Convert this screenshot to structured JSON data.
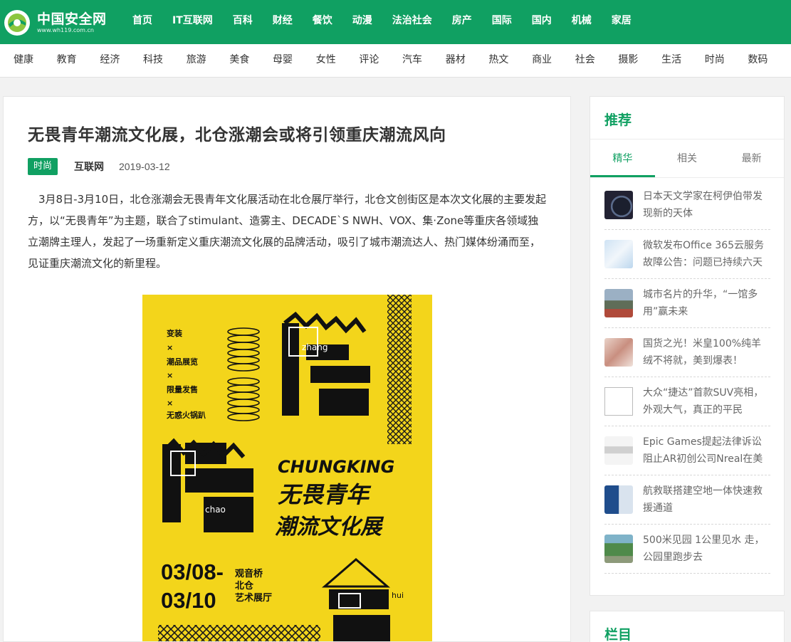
{
  "site": {
    "logo_text": "中国安全网",
    "logo_url": "www.wh119.com.cn",
    "brand_color": "#10a062"
  },
  "main_nav": [
    "首页",
    "IT互联网",
    "百科",
    "财经",
    "餐饮",
    "动漫",
    "法治社会",
    "房产",
    "国际",
    "国内",
    "机械",
    "家居"
  ],
  "sub_nav": [
    "健康",
    "教育",
    "经济",
    "科技",
    "旅游",
    "美食",
    "母婴",
    "女性",
    "评论",
    "汽车",
    "器材",
    "热文",
    "商业",
    "社会",
    "摄影",
    "生活",
    "时尚",
    "数码"
  ],
  "article": {
    "title": "无畏青年潮流文化展，北仓涨潮会或将引领重庆潮流风向",
    "tag": "时尚",
    "source": "互联网",
    "date": "2019-03-12",
    "body": "3月8日-3月10日，北仓涨潮会无畏青年文化展活动在北仓展厅举行，北仓文创街区是本次文化展的主要发起方，以“无畏青年”为主题，联合了stimulant、造雾主、DECADE`S NWH、VOX、集·Zone等重庆各领域独立潮牌主理人，发起了一场重新定义重庆潮流文化展的品牌活动，吸引了城市潮流达人、热门媒体纷涌而至，见证重庆潮流文化的新里程。",
    "poster": {
      "bg_color": "#f3d51b",
      "list": [
        "变装",
        "×",
        "潮品展览",
        "×",
        "限量发售",
        "×",
        "无惑火锅趴"
      ],
      "zhang_pinyin": "zhang",
      "chao_pinyin": "chao",
      "hui_pinyin": "hui",
      "city_en": "CHUNGKING",
      "headline_1": "无畏青年",
      "headline_2": "潮流文化展",
      "date_1": "03/08-",
      "date_2": "03/10",
      "venue_1": "观音桥",
      "venue_2": "北仓",
      "venue_3": "艺术展厅"
    }
  },
  "sidebar": {
    "title": "推荐",
    "tabs": [
      "精华",
      "相关",
      "最新"
    ],
    "active_tab": "精华",
    "items": [
      {
        "text": "日本天文学家在柯伊伯带发现新的天体",
        "thumb": "space"
      },
      {
        "text": "微软发布Office 365云服务故障公告：问题已持续六天",
        "thumb": "map"
      },
      {
        "text": "城市名片的升华，“一馆多用”赢未来",
        "thumb": "building"
      },
      {
        "text": "国货之光！米皇100%纯羊绒不将就，美到爆表！",
        "thumb": "fabric"
      },
      {
        "text": "大众“捷达”首款SUV亮相，外观大气，真正的平民",
        "thumb": "broken"
      },
      {
        "text": "Epic Games提起法律诉讼阻止AR初创公司Nreal在美",
        "thumb": "glasses"
      },
      {
        "text": "航救联搭建空地一体快速救援通道",
        "thumb": "rescue"
      },
      {
        "text": "500米见园 1公里见水 走，公园里跑步去",
        "thumb": "park"
      }
    ],
    "section2_title": "栏目"
  }
}
